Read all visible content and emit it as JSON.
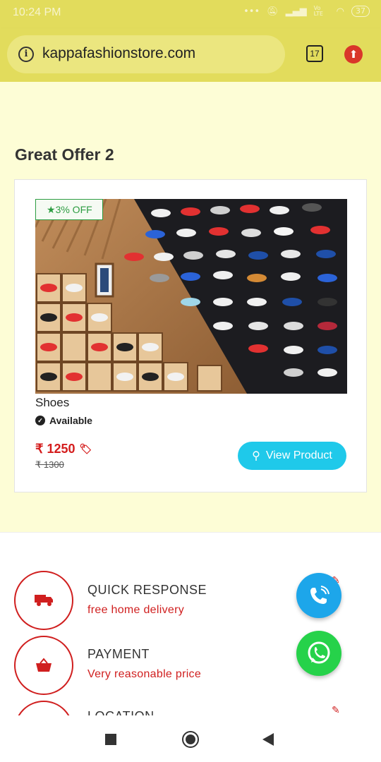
{
  "status_bar": {
    "time": "10:24 PM",
    "carrier": "Vo LTE",
    "battery": "37"
  },
  "browser": {
    "url": "kappafashionstore.com",
    "tab_count": "17"
  },
  "section": {
    "title": "Great Offer 2"
  },
  "product": {
    "badge": "3% OFF",
    "name": "Shoes",
    "availability": "Available",
    "price": "₹ 1250",
    "old_price": "₹ 1300",
    "view_button": "View Product"
  },
  "features": [
    {
      "title": "QUICK RESPONSE",
      "subtitle": "free home delivery",
      "icon": "truck-icon"
    },
    {
      "title": "PAYMENT",
      "subtitle": "Very reasonable price",
      "icon": "basket-icon"
    },
    {
      "title": "LOCATION",
      "subtitle": "",
      "icon": "location-icon"
    }
  ],
  "colors": {
    "header": "#e2dc5c",
    "background": "#fdfdd6",
    "accent_red": "#d01f1f",
    "button": "#1fc9ea",
    "whatsapp": "#26d24a",
    "call": "#1da6ea"
  }
}
